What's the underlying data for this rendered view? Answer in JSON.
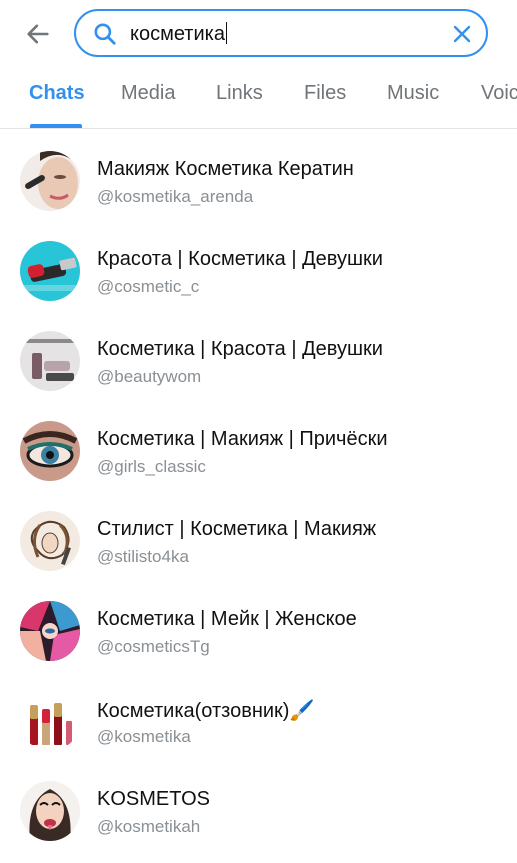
{
  "search": {
    "query": "косметика"
  },
  "tabs": [
    {
      "label": "Chats"
    },
    {
      "label": "Media"
    },
    {
      "label": "Links"
    },
    {
      "label": "Files"
    },
    {
      "label": "Music"
    },
    {
      "label": "Voic"
    }
  ],
  "results": [
    {
      "title": "Макияж Косметика Кератин",
      "handle": "@kosmetika_arenda"
    },
    {
      "title": "Красота | Косметика | Девушки",
      "handle": "@cosmetic_c"
    },
    {
      "title": "Косметика | Красота | Девушки",
      "handle": "@beautywom"
    },
    {
      "title": "Косметика | Макияж | Причёски",
      "handle": "@girls_classic"
    },
    {
      "title": "Стилист | Косметика | Макияж",
      "handle": "@stilisto4ka"
    },
    {
      "title": "Косметика | Мейк | Женское",
      "handle": "@cosmeticsTg"
    },
    {
      "title": "Косметика(отзовник)🖌️",
      "handle": "@kosmetika"
    },
    {
      "title": "KOSMETOS",
      "handle": "@kosmetikah"
    }
  ],
  "colors": {
    "accent": "#3390ec",
    "secondary_text": "#8a8f94"
  }
}
